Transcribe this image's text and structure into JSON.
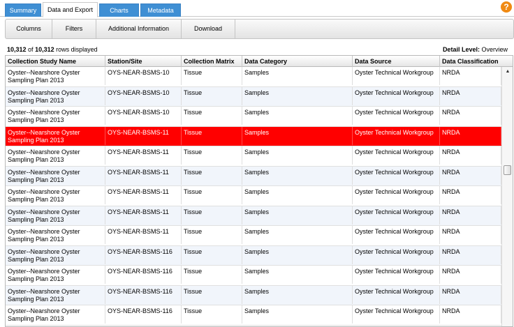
{
  "tabs": [
    {
      "label": "Summary",
      "active": false
    },
    {
      "label": "Data and Export",
      "active": true
    },
    {
      "label": "Charts",
      "active": false
    },
    {
      "label": "Metadata",
      "active": false
    }
  ],
  "help_icon": "question-mark-icon",
  "toolbar": {
    "columns": "Columns",
    "filters": "Filters",
    "additional": "Additional Information",
    "download": "Download"
  },
  "summary": {
    "shown": "10,312",
    "of_text": "of",
    "total": "10,312",
    "suffix": "rows displayed",
    "detail_label": "Detail Level:",
    "detail_value": "Overview"
  },
  "columns": [
    "Collection Study Name",
    "Station/Site",
    "Collection Matrix",
    "Data Category",
    "Data Source",
    "Data Classification"
  ],
  "rows": [
    {
      "study": "Oyster--Nearshore Oyster Sampling Plan 2013",
      "site": "OYS-NEAR-BSMS-10",
      "matrix": "Tissue",
      "category": "Samples",
      "source": "Oyster Technical Workgroup",
      "classification": "NRDA"
    },
    {
      "study": "Oyster--Nearshore Oyster Sampling Plan 2013",
      "site": "OYS-NEAR-BSMS-10",
      "matrix": "Tissue",
      "category": "Samples",
      "source": "Oyster Technical Workgroup",
      "classification": "NRDA"
    },
    {
      "study": "Oyster--Nearshore Oyster Sampling Plan 2013",
      "site": "OYS-NEAR-BSMS-10",
      "matrix": "Tissue",
      "category": "Samples",
      "source": "Oyster Technical Workgroup",
      "classification": "NRDA"
    },
    {
      "study": "Oyster--Nearshore Oyster Sampling Plan 2013",
      "site": "OYS-NEAR-BSMS-11",
      "matrix": "Tissue",
      "category": "Samples",
      "source": "Oyster Technical Workgroup",
      "classification": "NRDA"
    },
    {
      "study": "Oyster--Nearshore Oyster Sampling Plan 2013",
      "site": "OYS-NEAR-BSMS-11",
      "matrix": "Tissue",
      "category": "Samples",
      "source": "Oyster Technical Workgroup",
      "classification": "NRDA"
    },
    {
      "study": "Oyster--Nearshore Oyster Sampling Plan 2013",
      "site": "OYS-NEAR-BSMS-11",
      "matrix": "Tissue",
      "category": "Samples",
      "source": "Oyster Technical Workgroup",
      "classification": "NRDA"
    },
    {
      "study": "Oyster--Nearshore Oyster Sampling Plan 2013",
      "site": "OYS-NEAR-BSMS-11",
      "matrix": "Tissue",
      "category": "Samples",
      "source": "Oyster Technical Workgroup",
      "classification": "NRDA"
    },
    {
      "study": "Oyster--Nearshore Oyster Sampling Plan 2013",
      "site": "OYS-NEAR-BSMS-11",
      "matrix": "Tissue",
      "category": "Samples",
      "source": "Oyster Technical Workgroup",
      "classification": "NRDA"
    },
    {
      "study": "Oyster--Nearshore Oyster Sampling Plan 2013",
      "site": "OYS-NEAR-BSMS-11",
      "matrix": "Tissue",
      "category": "Samples",
      "source": "Oyster Technical Workgroup",
      "classification": "NRDA"
    },
    {
      "study": "Oyster--Nearshore Oyster Sampling Plan 2013",
      "site": "OYS-NEAR-BSMS-116",
      "matrix": "Tissue",
      "category": "Samples",
      "source": "Oyster Technical Workgroup",
      "classification": "NRDA"
    },
    {
      "study": "Oyster--Nearshore Oyster Sampling Plan 2013",
      "site": "OYS-NEAR-BSMS-116",
      "matrix": "Tissue",
      "category": "Samples",
      "source": "Oyster Technical Workgroup",
      "classification": "NRDA"
    },
    {
      "study": "Oyster--Nearshore Oyster Sampling Plan 2013",
      "site": "OYS-NEAR-BSMS-116",
      "matrix": "Tissue",
      "category": "Samples",
      "source": "Oyster Technical Workgroup",
      "classification": "NRDA"
    },
    {
      "study": "Oyster--Nearshore Oyster Sampling Plan 2013",
      "site": "OYS-NEAR-BSMS-116",
      "matrix": "Tissue",
      "category": "Samples",
      "source": "Oyster Technical Workgroup",
      "classification": "NRDA"
    }
  ],
  "selected_row": 3,
  "colors": {
    "selected": "#ff0000",
    "tab_inactive": "#3f8fd4",
    "help": "#f08a13"
  }
}
